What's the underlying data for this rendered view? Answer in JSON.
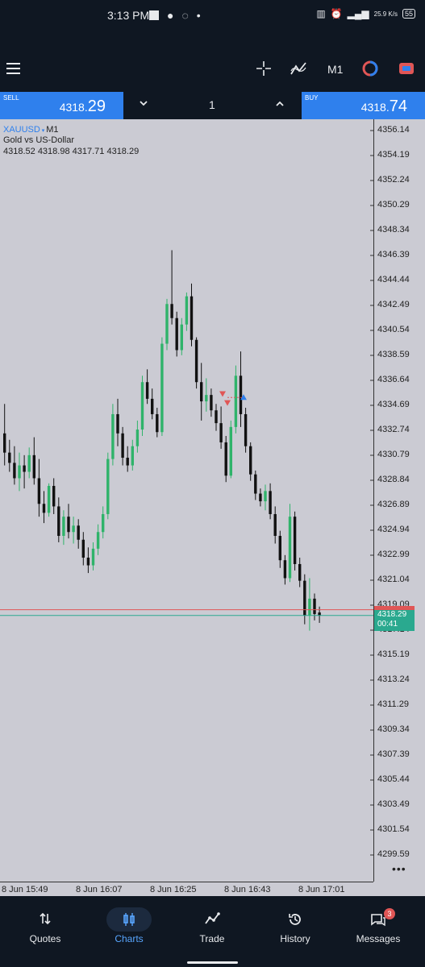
{
  "status_bar": {
    "time": "3:13 PM",
    "network_speed": "25.9 K/s",
    "battery": "55"
  },
  "toolbar": {
    "menu_icon": "hamburger-icon",
    "crosshair_icon": "crosshair-icon",
    "indicators_icon": "indicators-icon",
    "timeframe": "M1",
    "objects_icon": "objects-icon",
    "trade_icon": "one-click-trade-icon"
  },
  "trade_bar": {
    "sell_label": "SELL",
    "sell_price_main": "4318.",
    "sell_price_big": "29",
    "buy_label": "BUY",
    "buy_price_main": "4318.",
    "buy_price_big": "74",
    "lot": "1"
  },
  "chart": {
    "symbol": "XAUUSD",
    "timeframe_tag": "M1",
    "description": "Gold vs US-Dollar",
    "ohlc": "4318.52 4318.98 4317.71 4318.29",
    "current_bid": "4318.29",
    "countdown": "00:41",
    "colors": {
      "bull": "#2fb36a",
      "bear": "#111111",
      "bid_line": "#2aa98f",
      "ask_line": "#e05656",
      "background": "#cbcbd3"
    }
  },
  "chart_data": {
    "type": "candlestick",
    "symbol": "XAUUSD",
    "y_ticks": [
      "4356.14",
      "4354.19",
      "4352.24",
      "4350.29",
      "4348.34",
      "4346.39",
      "4344.44",
      "4342.49",
      "4340.54",
      "4338.59",
      "4336.64",
      "4334.69",
      "4332.74",
      "4330.79",
      "4328.84",
      "4326.89",
      "4324.94",
      "4322.99",
      "4321.04",
      "4319.09",
      "4317.14",
      "4315.19",
      "4313.24",
      "4311.29",
      "4309.34",
      "4307.39",
      "4305.44",
      "4303.49",
      "4301.54",
      "4299.59"
    ],
    "x_ticks": [
      "8 Jun 15:49",
      "8 Jun 16:07",
      "8 Jun 16:25",
      "8 Jun 16:43",
      "8 Jun 17:01"
    ],
    "ylim": [
      4298.5,
      4357.2
    ],
    "candles": [
      [
        4332.5,
        4334.8,
        4330.0,
        4331.0
      ],
      [
        4331.0,
        4332.0,
        4329.5,
        4330.2
      ],
      [
        4330.2,
        4331.5,
        4328.5,
        4329.0
      ],
      [
        4329.0,
        4331.0,
        4328.0,
        4330.0
      ],
      [
        4330.0,
        4330.8,
        4328.2,
        4329.5
      ],
      [
        4329.5,
        4331.4,
        4329.0,
        4330.8
      ],
      [
        4330.8,
        4332.2,
        4328.5,
        4329.0
      ],
      [
        4329.0,
        4330.5,
        4326.0,
        4327.0
      ],
      [
        4327.0,
        4328.0,
        4325.5,
        4326.3
      ],
      [
        4326.3,
        4328.6,
        4326.0,
        4328.4
      ],
      [
        4328.4,
        4329.0,
        4326.2,
        4326.8
      ],
      [
        4326.8,
        4327.5,
        4324.0,
        4324.5
      ],
      [
        4324.5,
        4326.5,
        4323.8,
        4326.0
      ],
      [
        4326.0,
        4327.0,
        4324.3,
        4324.8
      ],
      [
        4324.8,
        4326.0,
        4323.9,
        4325.3
      ],
      [
        4325.3,
        4325.8,
        4323.5,
        4324.2
      ],
      [
        4324.2,
        4324.8,
        4322.2,
        4322.8
      ],
      [
        4322.8,
        4323.6,
        4321.6,
        4322.2
      ],
      [
        4322.2,
        4324.0,
        4321.8,
        4323.5
      ],
      [
        4323.5,
        4325.4,
        4323.0,
        4324.8
      ],
      [
        4324.8,
        4326.8,
        4324.3,
        4326.2
      ],
      [
        4326.2,
        4331.0,
        4325.8,
        4330.5
      ],
      [
        4330.5,
        4334.8,
        4330.0,
        4334.0
      ],
      [
        4334.0,
        4335.2,
        4331.5,
        4332.5
      ],
      [
        4332.5,
        4333.0,
        4330.0,
        4330.6
      ],
      [
        4330.6,
        4331.5,
        4329.5,
        4330.0
      ],
      [
        4330.0,
        4332.0,
        4329.6,
        4331.5
      ],
      [
        4331.5,
        4333.5,
        4331.0,
        4332.8
      ],
      [
        4332.8,
        4337.0,
        4332.3,
        4336.5
      ],
      [
        4336.5,
        4337.5,
        4334.8,
        4335.2
      ],
      [
        4335.2,
        4336.0,
        4333.6,
        4334.0
      ],
      [
        4334.0,
        4334.5,
        4332.2,
        4332.6
      ],
      [
        4332.6,
        4340.0,
        4332.3,
        4339.5
      ],
      [
        4339.5,
        4343.0,
        4339.0,
        4342.6
      ],
      [
        4342.6,
        4346.8,
        4341.0,
        4341.5
      ],
      [
        4341.5,
        4342.0,
        4338.5,
        4339.0
      ],
      [
        4339.0,
        4341.5,
        4338.6,
        4341.0
      ],
      [
        4341.0,
        4343.5,
        4340.5,
        4343.2
      ],
      [
        4343.2,
        4344.2,
        4339.3,
        4339.8
      ],
      [
        4339.8,
        4340.0,
        4336.0,
        4336.5
      ],
      [
        4336.5,
        4338.0,
        4333.5,
        4335.0
      ],
      [
        4335.0,
        4336.8,
        4334.2,
        4335.5
      ],
      [
        4335.5,
        4336.0,
        4333.8,
        4334.3
      ],
      [
        4334.3,
        4334.8,
        4332.7,
        4333.3
      ],
      [
        4333.3,
        4334.6,
        4331.3,
        4331.8
      ],
      [
        4331.8,
        4332.3,
        4328.7,
        4329.2
      ],
      [
        4329.2,
        4333.5,
        4329.0,
        4333.0
      ],
      [
        4333.0,
        4337.8,
        4332.5,
        4337.0
      ],
      [
        4337.0,
        4338.9,
        4333.0,
        4334.0
      ],
      [
        4334.0,
        4334.5,
        4331.0,
        4331.5
      ],
      [
        4331.5,
        4331.8,
        4328.8,
        4329.3
      ],
      [
        4329.3,
        4329.6,
        4327.3,
        4327.8
      ],
      [
        4327.8,
        4328.2,
        4326.8,
        4327.2
      ],
      [
        4327.2,
        4328.5,
        4326.5,
        4328.0
      ],
      [
        4328.0,
        4328.6,
        4325.8,
        4326.2
      ],
      [
        4326.2,
        4326.8,
        4323.9,
        4324.5
      ],
      [
        4324.5,
        4324.9,
        4322.0,
        4322.6
      ],
      [
        4322.6,
        4323.0,
        4320.7,
        4321.2
      ],
      [
        4321.2,
        4327.0,
        4320.9,
        4326.0
      ],
      [
        4326.0,
        4326.4,
        4321.8,
        4322.3
      ],
      [
        4322.3,
        4322.8,
        4320.5,
        4321.0
      ],
      [
        4321.0,
        4321.5,
        4317.6,
        4318.3
      ],
      [
        4318.3,
        4321.2,
        4317.1,
        4319.6
      ],
      [
        4319.6,
        4320.0,
        4317.9,
        4318.4
      ],
      [
        4318.52,
        4318.98,
        4317.71,
        4318.29
      ]
    ],
    "bid": 4318.29,
    "ask": 4318.74,
    "markers": [
      {
        "type": "sell",
        "price": 4335.6
      },
      {
        "type": "sell",
        "price": 4334.9
      },
      {
        "type": "buy",
        "price": 4335.3
      }
    ]
  },
  "nav": {
    "items": [
      {
        "label": "Quotes",
        "icon": "quotes-icon"
      },
      {
        "label": "Charts",
        "icon": "charts-icon"
      },
      {
        "label": "Trade",
        "icon": "trade-icon"
      },
      {
        "label": "History",
        "icon": "history-icon"
      },
      {
        "label": "Messages",
        "icon": "messages-icon",
        "badge": "3"
      }
    ],
    "active": "Charts"
  }
}
